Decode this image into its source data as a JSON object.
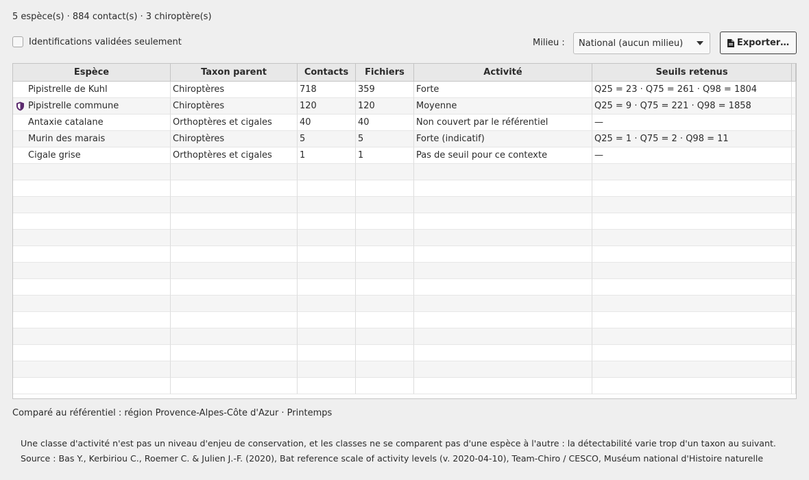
{
  "summary": "5 espèce(s) · 884 contact(s) · 3 chiroptère(s)",
  "filter": {
    "validated_label": "Identifications validées seulement",
    "checked": false
  },
  "milieu": {
    "label": "Milieu :",
    "value": "National (aucun milieu)"
  },
  "export": {
    "label": "Exporter…"
  },
  "table": {
    "headers": [
      "Espèce",
      "Taxon parent",
      "Contacts",
      "Fichiers",
      "Activité",
      "Seuils retenus"
    ],
    "rows": [
      {
        "species": "Pipistrelle de Kuhl",
        "parent": "Chiroptères",
        "contacts": "718",
        "files": "359",
        "activity": "Forte",
        "thresholds": "Q25 = 23 · Q75 = 261 · Q98 = 1804",
        "icon": ""
      },
      {
        "species": "Pipistrelle commune",
        "parent": "Chiroptères",
        "contacts": "120",
        "files": "120",
        "activity": "Moyenne",
        "thresholds": "Q25 = 9 · Q75 = 221 · Q98 = 1858",
        "icon": "shield-icon"
      },
      {
        "species": "Antaxie catalane",
        "parent": "Orthoptères et cigales",
        "contacts": "40",
        "files": "40",
        "activity": "Non couvert par le référentiel",
        "thresholds": "—",
        "icon": ""
      },
      {
        "species": "Murin des marais",
        "parent": "Chiroptères",
        "contacts": "5",
        "files": "5",
        "activity": "Forte (indicatif)",
        "thresholds": "Q25 = 1 · Q75 = 2 · Q98 = 11",
        "icon": ""
      },
      {
        "species": "Cigale grise",
        "parent": "Orthoptères et cigales",
        "contacts": "1",
        "files": "1",
        "activity": "Pas de seuil pour ce contexte",
        "thresholds": "—",
        "icon": ""
      }
    ]
  },
  "reference": "Comparé au référentiel : région Provence-Alpes-Côte d'Azur · Printemps",
  "note": {
    "line1": "Une classe d'activité n'est pas un niveau d'enjeu de conservation, et les classes ne se comparent pas d'une espèce à l'autre : la détectabilité varie trop d'un taxon au suivant.",
    "line2": "Source : Bas Y., Kerbiriou C., Roemer C. & Julien J.-F. (2020), Bat reference scale of activity levels (v. 2020-04-10), Team-Chiro / CESCO, Muséum national d'Histoire naturelle"
  },
  "colors": {
    "shield": "#5b2a6e",
    "accent": "#3a3a3a"
  }
}
